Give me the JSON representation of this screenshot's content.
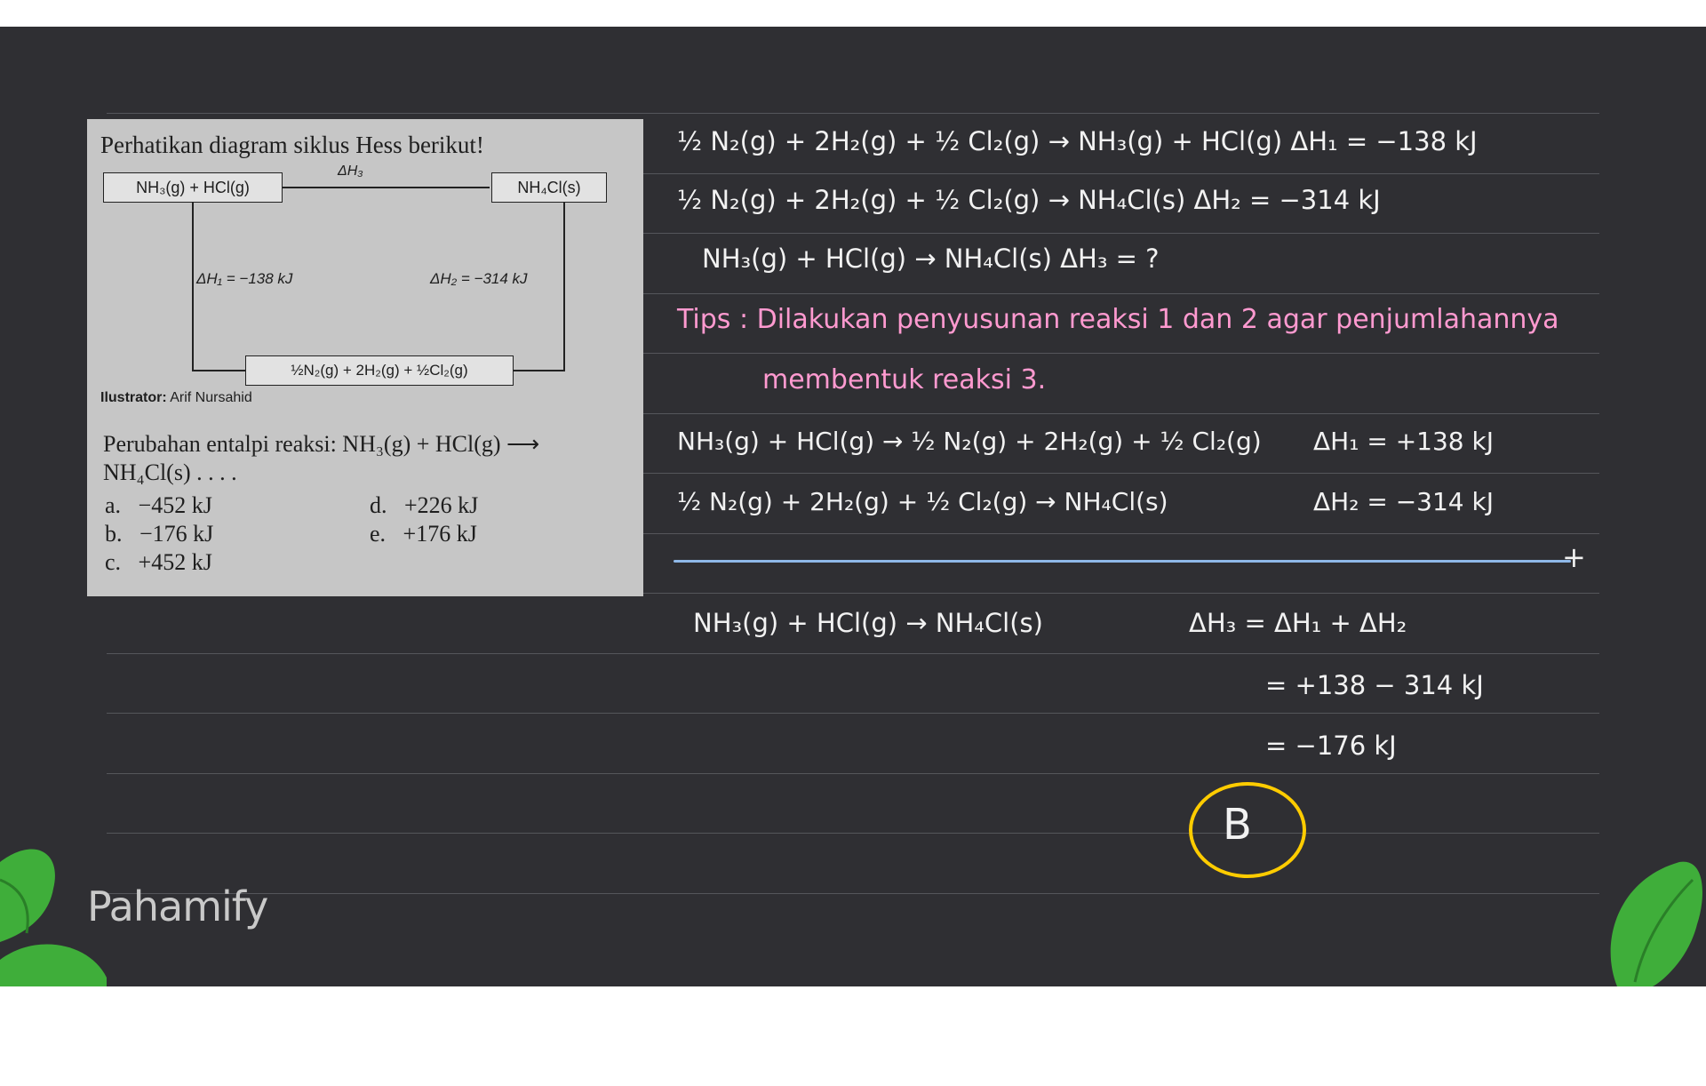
{
  "question": {
    "title": "Perhatikan diagram siklus Hess berikut!",
    "box_left": "NH₃(g) + HCl(g)",
    "box_right": "NH₄Cl(s)",
    "dh3": "ΔH₃",
    "dh1": "ΔH₁ = −138 kJ",
    "dh2": "ΔH₂ = −314 kJ",
    "box_bottom": "½N₂(g) + 2H₂(g) + ½Cl₂(g)",
    "illustrator_label": "Ilustrator:",
    "illustrator_name": "Arif Nursahid",
    "prompt_line1": "Perubahan entalpi reaksi: NH₃(g) + HCl(g) ⟶",
    "prompt_line2": "NH₄Cl(s) . . . .",
    "options": [
      {
        "letter": "a.",
        "value": "−452 kJ"
      },
      {
        "letter": "b.",
        "value": "−176 kJ"
      },
      {
        "letter": "c.",
        "value": "+452 kJ"
      },
      {
        "letter": "d.",
        "value": "+226 kJ"
      },
      {
        "letter": "e.",
        "value": "+176 kJ"
      }
    ]
  },
  "solution": {
    "eq1": "½ N₂(g) + 2H₂(g) + ½ Cl₂(g) → NH₃(g) + HCl(g)   ΔH₁ = −138 kJ",
    "eq2": "½ N₂(g) + 2H₂(g) + ½ Cl₂(g) → NH₄Cl(s)   ΔH₂ = −314 kJ",
    "eq3": "NH₃(g) + HCl(g) → NH₄Cl(s)   ΔH₃ = ?",
    "tips1": "Tips : Dilakukan penyusunan reaksi 1 dan 2 agar penjumlahannya",
    "tips2": "membentuk reaksi 3.",
    "rev1": "NH₃(g) + HCl(g) → ½ N₂(g) + 2H₂(g) + ½ Cl₂(g)",
    "rev1_dh": "ΔH₁ = +138 kJ",
    "rev2": "½ N₂(g) + 2H₂(g) + ½ Cl₂(g) → NH₄Cl(s)",
    "rev2_dh": "ΔH₂ = −314 kJ",
    "plus": "+",
    "result": "NH₃(g) + HCl(g) → NH₄Cl(s)",
    "calc1": "ΔH₃ = ΔH₁ + ΔH₂",
    "calc2": "= +138 − 314 kJ",
    "calc3": "= −176 kJ",
    "answer": "B"
  },
  "brand": {
    "logo": "Pahamify"
  },
  "colors": {
    "board": "#2f2f33",
    "highlight": "#ffcc00",
    "tips": "#ff9ad0",
    "separator": "#8fb8e8",
    "leaf": "#3fae3a"
  }
}
